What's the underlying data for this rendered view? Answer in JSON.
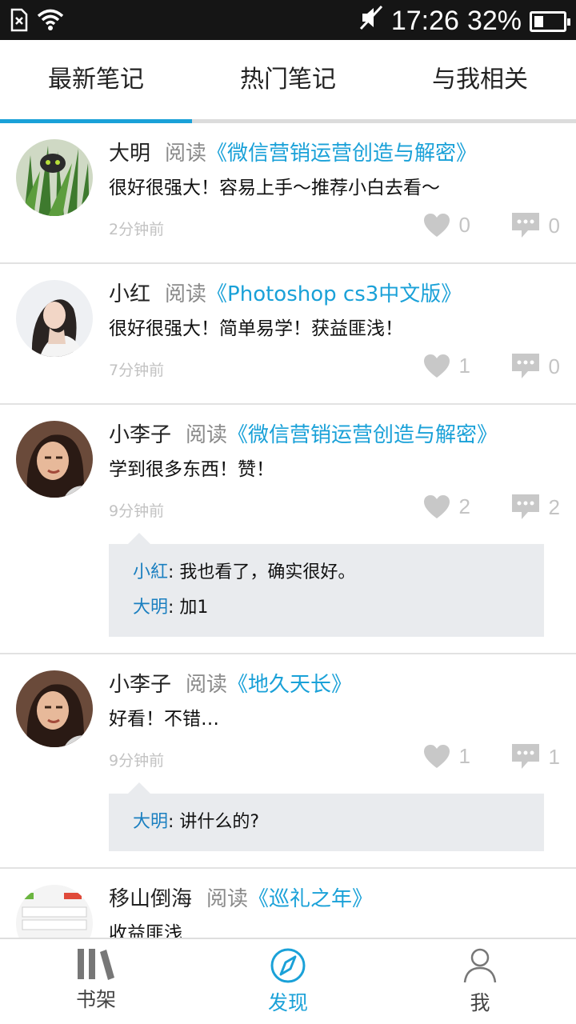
{
  "status_bar": {
    "time": "17:26",
    "battery": "32%",
    "battery_level": 0.32
  },
  "tabs": [
    {
      "label": "最新笔记"
    },
    {
      "label": "热门笔记"
    },
    {
      "label": "与我相关"
    }
  ],
  "active_tab": 0,
  "posts": [
    {
      "user": "大明",
      "read_word": "阅读",
      "book": "《微信营销运营创造与解密》",
      "text": "很好很强大！容易上手～推荐小白去看～",
      "time": "2分钟前",
      "likes": "0",
      "comments": "0",
      "replies": []
    },
    {
      "user": "小红",
      "read_word": "阅读",
      "book": "《Photoshop cs3中文版》",
      "text": "很好很强大！简单易学！获益匪浅！",
      "time": "7分钟前",
      "likes": "1",
      "comments": "0",
      "replies": []
    },
    {
      "user": "小李子",
      "read_word": "阅读",
      "book": "《微信营销运营创造与解密》",
      "text": "学到很多东西！赞！",
      "time": "9分钟前",
      "likes": "2",
      "comments": "2",
      "replies": [
        {
          "name": "小紅",
          "text": ": 我也看了，确实很好。"
        },
        {
          "name": "大明",
          "text": ": 加1"
        }
      ]
    },
    {
      "user": "小李子",
      "read_word": "阅读",
      "book": "《地久天长》",
      "text": "好看！不错…",
      "time": "9分钟前",
      "likes": "1",
      "comments": "1",
      "replies": [
        {
          "name": "大明",
          "text": ": 讲什么的?"
        }
      ]
    },
    {
      "user": "移山倒海",
      "read_word": "阅读",
      "book": "《巡礼之年》",
      "text": "收益匪浅",
      "time": "",
      "likes": "",
      "comments": "",
      "replies": []
    }
  ],
  "bottom_nav": [
    {
      "label": "书架",
      "icon": "bookshelf-icon"
    },
    {
      "label": "发现",
      "icon": "compass-icon"
    },
    {
      "label": "我",
      "icon": "person-icon"
    }
  ],
  "active_nav": 1,
  "colors": {
    "accent": "#1aa1d8",
    "reply_name": "#1a7fc0",
    "muted": "#c4c4c4",
    "reply_bg": "#e9ebee",
    "statusbar": "#151515"
  }
}
